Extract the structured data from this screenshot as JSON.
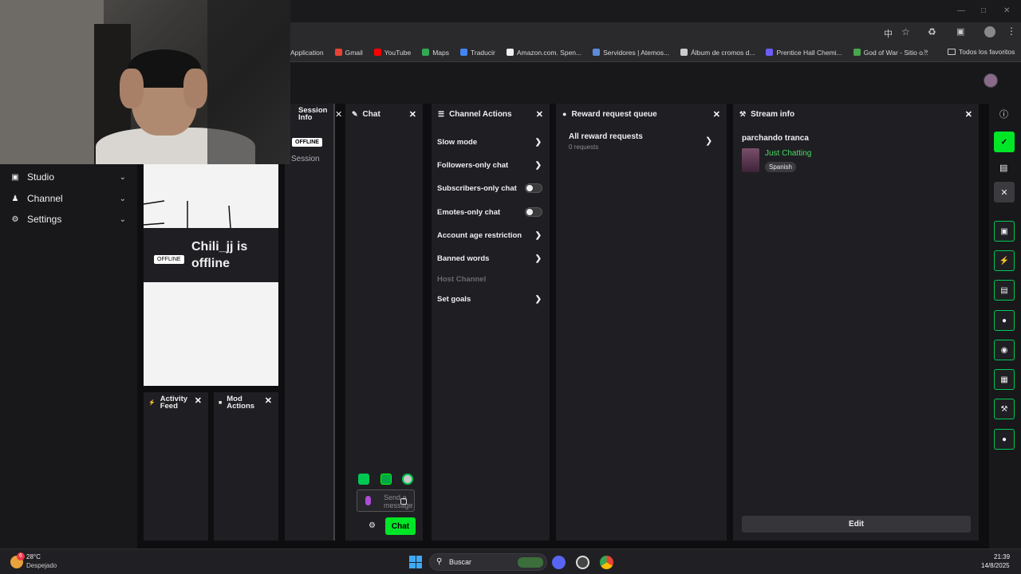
{
  "browser": {
    "bookmarks": [
      {
        "label": "Application",
        "color": "#6c6cff"
      },
      {
        "label": "Gmail",
        "color": "#ea4335"
      },
      {
        "label": "YouTube",
        "color": "#ff0000"
      },
      {
        "label": "Maps",
        "color": "#34a853"
      },
      {
        "label": "Traducir",
        "color": "#4285f4"
      },
      {
        "label": "Amazon.com. Spen...",
        "color": "#f0f0f0"
      },
      {
        "label": "Servidores | Atemos...",
        "color": "#5e8bd8"
      },
      {
        "label": "Álbum de cromos d...",
        "color": "#cccccc"
      },
      {
        "label": "Prentice Hall Chemi...",
        "color": "#6d5dfc"
      },
      {
        "label": "God of War - Sitio o...",
        "color": "#4aa64a"
      }
    ],
    "all_bookmarks": "Todos los favoritos"
  },
  "sidebar": {
    "items": [
      {
        "label": "Studio"
      },
      {
        "label": "Channel"
      },
      {
        "label": "Settings"
      }
    ]
  },
  "session_info": {
    "title": "Session Info",
    "badge": "OFFLINE",
    "link": "Session"
  },
  "preview": {
    "badge": "OFFLINE",
    "status": "Chili_jj is offline"
  },
  "activity_feed": {
    "title": "Activity Feed"
  },
  "mod_actions": {
    "title": "Mod Actions"
  },
  "chat": {
    "title": "Chat",
    "placeholder": "Send a message",
    "send_label": "Chat"
  },
  "channel_actions": {
    "title": "Channel Actions",
    "items": [
      {
        "label": "Slow mode"
      },
      {
        "label": "Followers-only chat"
      },
      {
        "label": "Subscribers-only chat"
      },
      {
        "label": "Emotes-only chat"
      },
      {
        "label": "Account age restriction"
      },
      {
        "label": "Banned words"
      },
      {
        "label": "Host Channel"
      },
      {
        "label": "Set goals"
      }
    ]
  },
  "reward_queue": {
    "title": "Reward request queue",
    "all_label": "All reward requests",
    "count_label": "0 requests"
  },
  "stream_info": {
    "title": "Stream info",
    "stream_title": "parchando tranca",
    "category": "Just Chatting",
    "tag": "Spanish",
    "edit_label": "Edit"
  },
  "taskbar": {
    "temperature": "28°C",
    "weather": "Despejado",
    "weather_badge": "6",
    "search_label": "Buscar",
    "time": "21:39",
    "date": "14/8/2025"
  },
  "colors": {
    "accent": "#00e626",
    "category": "#4cd964"
  }
}
